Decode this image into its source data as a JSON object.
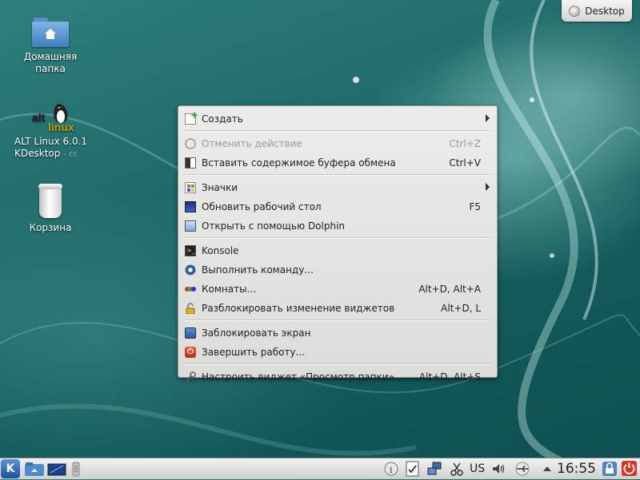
{
  "desktop_icons": [
    {
      "label_line1": "Домашняя",
      "label_line2": "папка",
      "icon": "home-folder-icon"
    },
    {
      "label_line1": "ALT Linux 6.0.1",
      "label_line2": "KDesktop",
      "label_tail": "- cc",
      "logo_text_top": "alt",
      "logo_text_bottom": "linux",
      "icon": "alt-linux-icon"
    },
    {
      "label_line1": "Корзина",
      "icon": "trash-icon"
    }
  ],
  "toolbox": {
    "label": "Desktop"
  },
  "context_menu": {
    "items": [
      {
        "label": "Создать",
        "shortcut": "",
        "submenu": true,
        "enabled": true,
        "icon": "create-new-icon"
      },
      {
        "label": "Отменить действие",
        "shortcut": "Ctrl+Z",
        "submenu": false,
        "enabled": false,
        "icon": "undo-icon"
      },
      {
        "label": "Вставить содержимое буфера обмена",
        "shortcut": "Ctrl+V",
        "submenu": false,
        "enabled": true,
        "icon": "paste-icon"
      },
      {
        "label": "Значки",
        "shortcut": "",
        "submenu": true,
        "enabled": true,
        "icon": "icons-view-icon"
      },
      {
        "label": "Обновить рабочий стол",
        "shortcut": "F5",
        "submenu": false,
        "enabled": true,
        "icon": "refresh-desktop-icon"
      },
      {
        "label": "Открыть с помощью Dolphin",
        "shortcut": "",
        "submenu": false,
        "enabled": true,
        "icon": "dolphin-icon"
      },
      {
        "label": "Konsole",
        "shortcut": "",
        "submenu": false,
        "enabled": true,
        "icon": "konsole-icon"
      },
      {
        "label": "Выполнить команду...",
        "shortcut": "",
        "submenu": false,
        "enabled": true,
        "icon": "run-command-icon"
      },
      {
        "label": "Комнаты...",
        "shortcut": "Alt+D, Alt+A",
        "submenu": false,
        "enabled": true,
        "icon": "activities-icon"
      },
      {
        "label": "Разблокировать изменение виджетов",
        "shortcut": "Alt+D, L",
        "submenu": false,
        "enabled": true,
        "icon": "unlock-widgets-icon"
      },
      {
        "label": "Заблокировать экран",
        "shortcut": "",
        "submenu": false,
        "enabled": true,
        "icon": "lock-screen-icon"
      },
      {
        "label": "Завершить работу...",
        "shortcut": "",
        "submenu": false,
        "enabled": true,
        "icon": "power-icon"
      },
      {
        "label": "Настроить виджет «Просмотр папки»",
        "shortcut": "Alt+D, Alt+S",
        "submenu": false,
        "enabled": true,
        "icon": "configure-widget-icon"
      }
    ]
  },
  "taskbar": {
    "kickoff_letter": "K",
    "language": "US",
    "clock": "16:55",
    "colors": {
      "menu_bg": "#e4e4e2",
      "disabled_text": "#9a9a9a",
      "desktop_teal": "#1f6b6a"
    }
  }
}
